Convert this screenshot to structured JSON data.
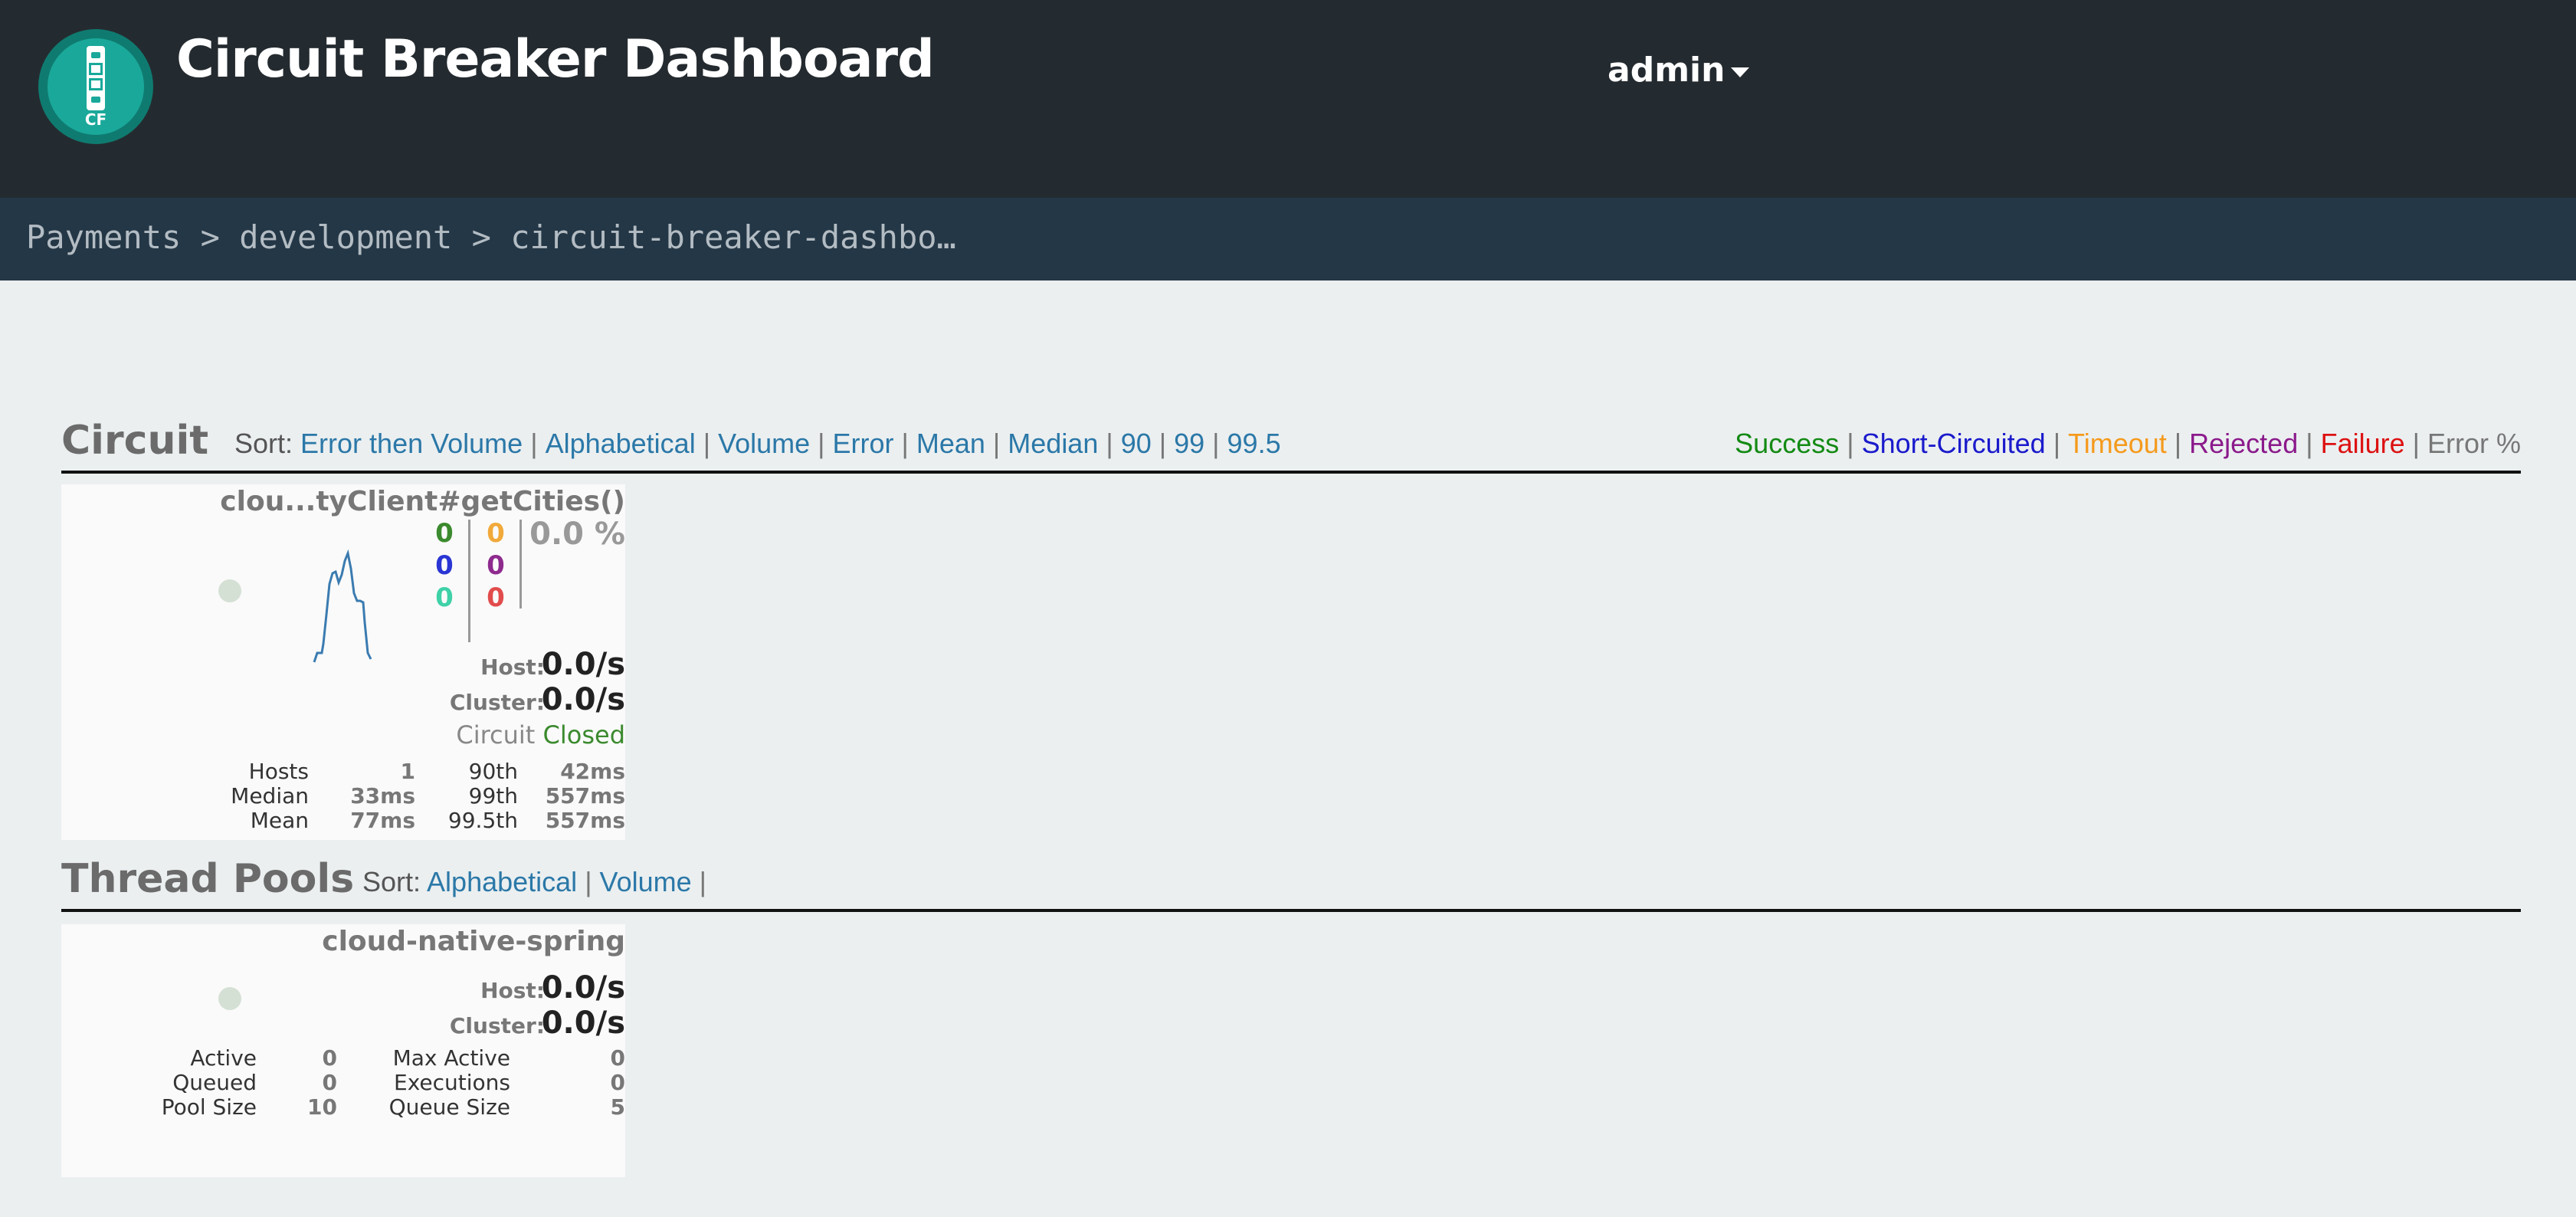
{
  "header": {
    "logo_text": "CF",
    "title": "Circuit Breaker Dashboard",
    "user": "admin"
  },
  "breadcrumb": {
    "org": "Payments",
    "sep1": ">",
    "space": "development",
    "sep2": ">",
    "service": "circuit-breaker-dashbo…"
  },
  "circuit_section": {
    "title": "Circuit",
    "sort_label": "Sort:",
    "sort_options": [
      "Error then Volume",
      "Alphabetical",
      "Volume",
      "Error",
      "Mean",
      "Median",
      "90",
      "99",
      "99.5"
    ],
    "legend": [
      {
        "label": "Success",
        "color": "#138a13"
      },
      {
        "label": "Short-Circuited",
        "color": "#1a1acc"
      },
      {
        "label": "Timeout",
        "color": "#f59a1c"
      },
      {
        "label": "Rejected",
        "color": "#8b1a8b"
      },
      {
        "label": "Failure",
        "color": "#dd1111"
      },
      {
        "label": "Error %",
        "color": "#777777"
      }
    ]
  },
  "circuit_card": {
    "name": "clou...tyClient#getCities()",
    "counts": {
      "success": "0",
      "short_circuited": "0",
      "bad_request": "0",
      "timeout": "0",
      "rejected": "0",
      "failure": "0"
    },
    "count_colors": {
      "success": "#3b8a2e",
      "short_circuited": "#2a35d4",
      "bad_request": "#3fd1a8",
      "timeout": "#f1a93a",
      "rejected": "#8e2a8e",
      "failure": "#e24c4c"
    },
    "error_percent": "0.0 %",
    "host_label": "Host:",
    "host_rate": "0.0/s",
    "cluster_label": "Cluster:",
    "cluster_rate": "0.0/s",
    "circuit_label": "Circuit",
    "circuit_status": "Closed",
    "stats": {
      "hosts_label": "Hosts",
      "hosts": "1",
      "median_label": "Median",
      "median": "33ms",
      "mean_label": "Mean",
      "mean": "77ms",
      "p90_label": "90th",
      "p90": "42ms",
      "p99_label": "99th",
      "p99": "557ms",
      "p995_label": "99.5th",
      "p995": "557ms"
    }
  },
  "threadpool_section": {
    "title": "Thread Pools",
    "sort_label": "Sort:",
    "sort_options": [
      "Alphabetical",
      "Volume"
    ]
  },
  "threadpool_card": {
    "name": "cloud-native-spring",
    "host_label": "Host:",
    "host_rate": "0.0/s",
    "cluster_label": "Cluster:",
    "cluster_rate": "0.0/s",
    "stats": {
      "active_label": "Active",
      "active": "0",
      "queued_label": "Queued",
      "queued": "0",
      "pool_size_label": "Pool Size",
      "pool_size": "10",
      "max_active_label": "Max Active",
      "max_active": "0",
      "executions_label": "Executions",
      "executions": "0",
      "queue_size_label": "Queue Size",
      "queue_size": "5"
    }
  }
}
